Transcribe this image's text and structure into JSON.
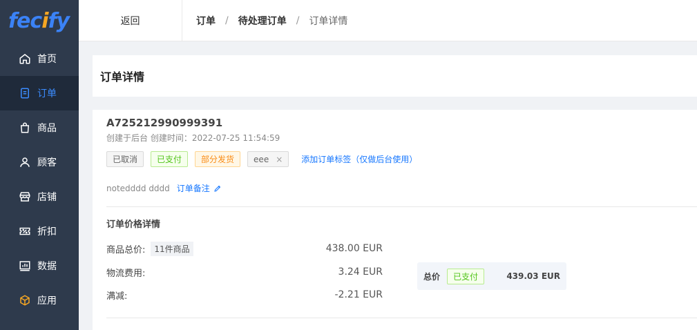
{
  "logo": "fecify",
  "sidebar": {
    "items": [
      {
        "label": "首页",
        "icon": "home-icon"
      },
      {
        "label": "订单",
        "icon": "order-icon"
      },
      {
        "label": "商品",
        "icon": "bag-icon"
      },
      {
        "label": "顾客",
        "icon": "user-icon"
      },
      {
        "label": "店铺",
        "icon": "store-icon"
      },
      {
        "label": "折扣",
        "icon": "discount-icon"
      },
      {
        "label": "数据",
        "icon": "chart-icon"
      },
      {
        "label": "应用",
        "icon": "cube-icon"
      }
    ],
    "active_index": 1
  },
  "topbar": {
    "back_label": "返回",
    "breadcrumb": [
      "订单",
      "待处理订单",
      "订单详情"
    ],
    "separator": "/"
  },
  "page_title": "订单详情",
  "order": {
    "number": "A725212990999391",
    "meta": "创建于后台 创建时间：2022-07-25 11:54:59",
    "tags": {
      "cancelled": "已取消",
      "paid": "已支付",
      "partial_shipped": "部分发货",
      "custom": "eee",
      "close": "×"
    },
    "add_tag_label": "添加订单标签（仅做后台使用）",
    "note_text": "notedddd dddd",
    "note_link": "订单备注"
  },
  "price_details": {
    "title": "订单价格详情",
    "rows": [
      {
        "label": "商品总价:",
        "badge": "11件商品",
        "value": "438.00 EUR"
      },
      {
        "label": "物流费用:",
        "value": "3.24 EUR"
      },
      {
        "label": "满减:",
        "value": "-2.21 EUR"
      }
    ],
    "total": {
      "label": "总价",
      "status": "已支付",
      "value": "439.03 EUR"
    }
  },
  "colors": {
    "sidebar_bg": "#2e3a4c",
    "sidebar_active_bg": "#1f2a3a",
    "accent": "#1677ff",
    "logo_blue": "#3b82f6",
    "logo_orange": "#f5a623"
  }
}
